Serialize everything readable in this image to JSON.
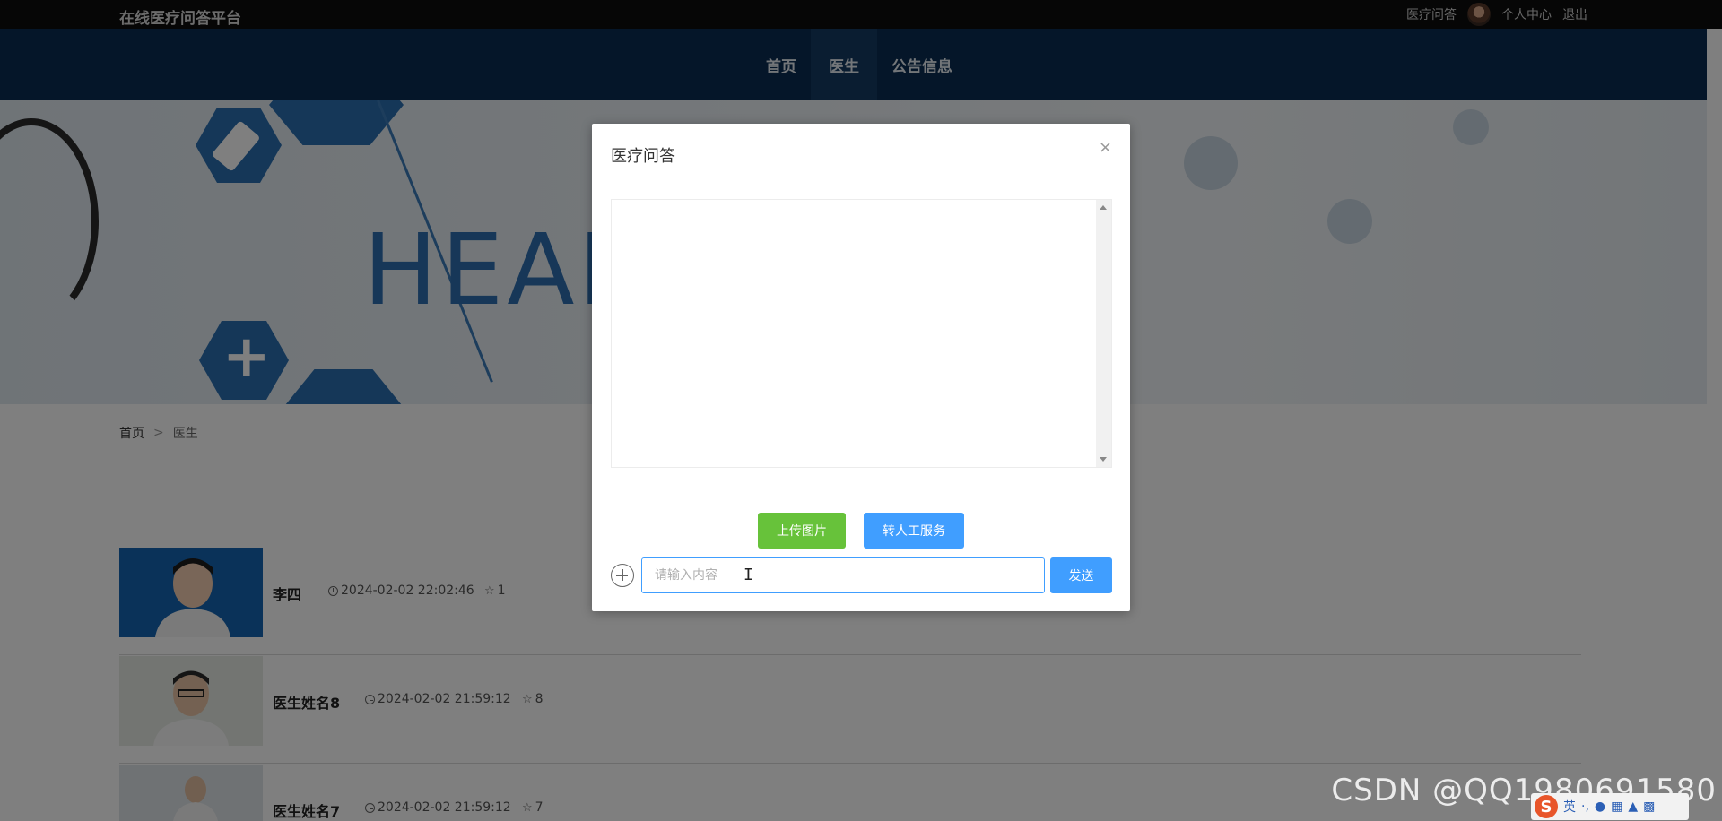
{
  "site": {
    "title": "在线医疗问答平台"
  },
  "topbar": {
    "links": [
      "医疗问答",
      "个人中心",
      "退出"
    ]
  },
  "nav": {
    "items": [
      "首页",
      "医生",
      "公告信息"
    ],
    "active_index": 1
  },
  "banner": {
    "text": "HEAL"
  },
  "breadcrumb": {
    "home": "首页",
    "separator": ">",
    "current": "医生"
  },
  "doctors": [
    {
      "name": "李四",
      "time": "2024-02-02 22:02:46",
      "stars": "1"
    },
    {
      "name": "医生姓名8",
      "time": "2024-02-02 21:59:12",
      "stars": "8"
    },
    {
      "name": "医生姓名7",
      "time": "2024-02-02 21:59:12",
      "stars": "7"
    }
  ],
  "modal": {
    "title": "医疗问答",
    "close": "×",
    "upload_label": "上传图片",
    "human_service_label": "转人工服务",
    "input_placeholder": "请输入内容",
    "send_label": "发送"
  },
  "watermark": "CSDN @QQ1980691580",
  "ime": {
    "lang": "英",
    "logo": "S"
  },
  "colors": {
    "nav_bg": "#0a2d52",
    "topbar_bg": "#0d0d0d",
    "primary": "#409eff",
    "success": "#67c23a"
  }
}
